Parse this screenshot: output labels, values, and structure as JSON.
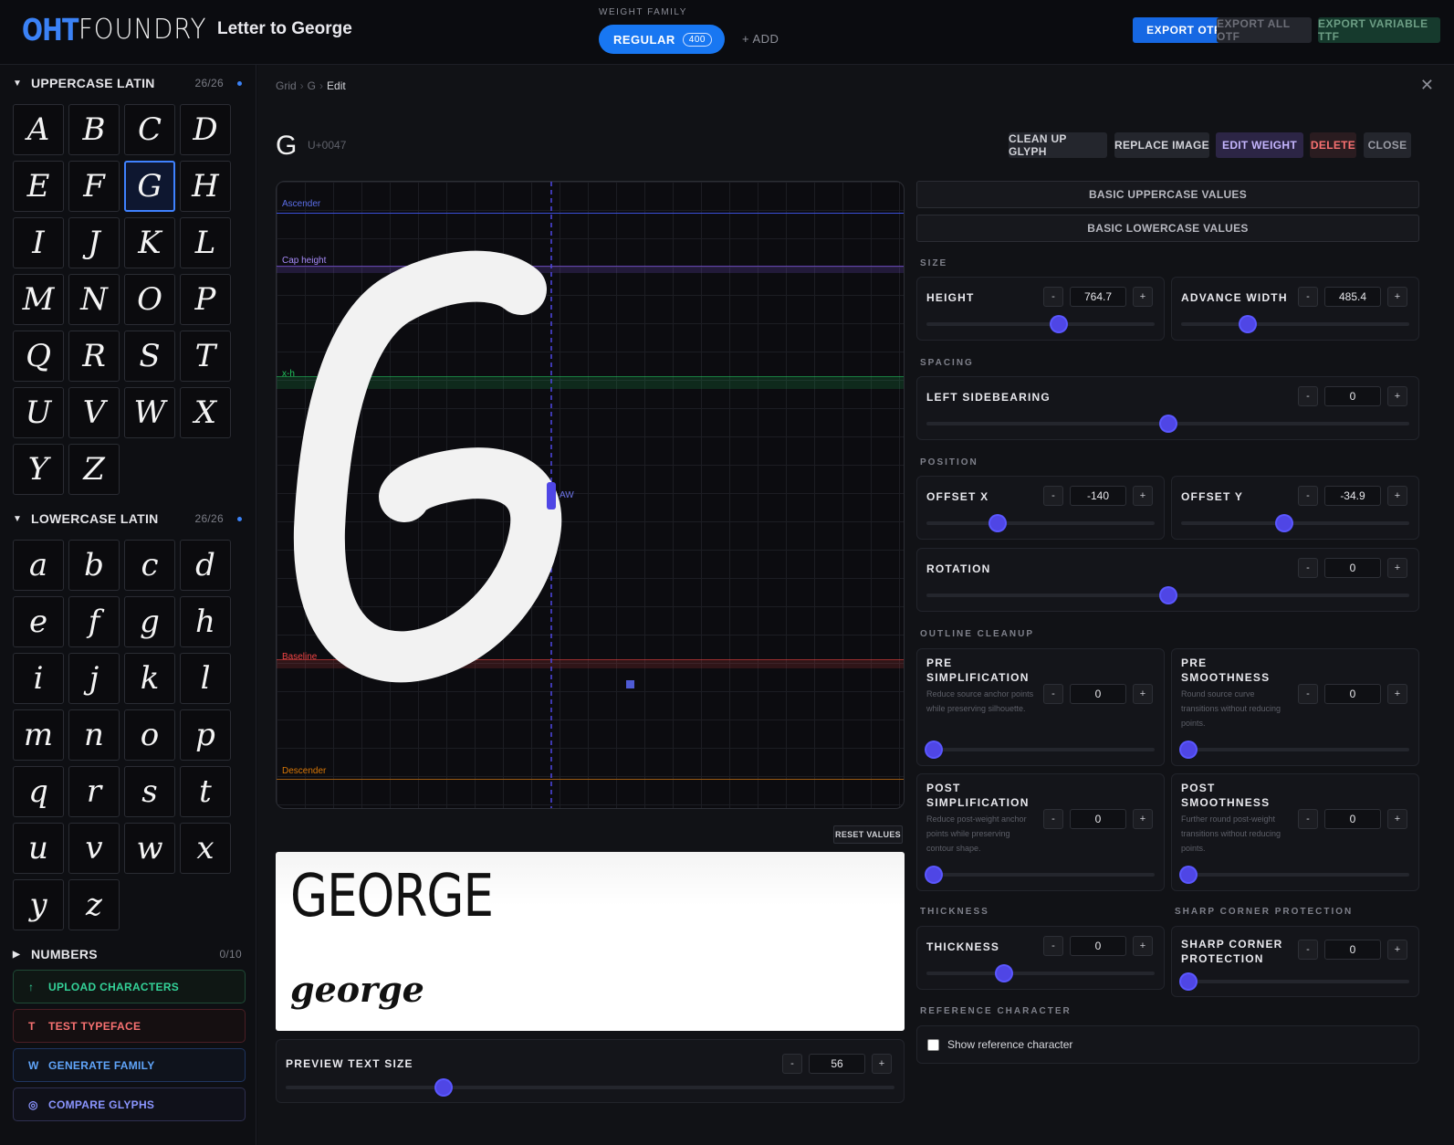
{
  "app": {
    "logo_left": "OHT",
    "logo_right": "FOUNDRY",
    "project_title": "Letter to George"
  },
  "weight_family": {
    "label": "WEIGHT FAMILY",
    "active_name": "REGULAR",
    "active_value": "400",
    "add_label": "+ ADD"
  },
  "export": {
    "otf": "EXPORT OTF",
    "all_otf": "EXPORT ALL OTF",
    "variable_ttf": "EXPORT VARIABLE TTF"
  },
  "sidebar": {
    "uppercase": {
      "title": "UPPERCASE LATIN",
      "count": "26/26",
      "glyphs": [
        "A",
        "B",
        "C",
        "D",
        "E",
        "F",
        "G",
        "H",
        "I",
        "J",
        "K",
        "L",
        "M",
        "N",
        "O",
        "P",
        "Q",
        "R",
        "S",
        "T",
        "U",
        "V",
        "W",
        "X",
        "Y",
        "Z"
      ]
    },
    "lowercase": {
      "title": "LOWERCASE LATIN",
      "count": "26/26",
      "glyphs": [
        "a",
        "b",
        "c",
        "d",
        "e",
        "f",
        "g",
        "h",
        "i",
        "j",
        "k",
        "l",
        "m",
        "n",
        "o",
        "p",
        "q",
        "r",
        "s",
        "t",
        "u",
        "v",
        "w",
        "x",
        "y",
        "z"
      ]
    },
    "numbers": {
      "title": "NUMBERS",
      "count": "0/10"
    },
    "actions": {
      "upload": "UPLOAD CHARACTERS",
      "test": "TEST TYPEFACE",
      "generate": "GENERATE FAMILY",
      "compare": "COMPARE GLYPHS",
      "upload_icon": "↑",
      "test_icon": "T",
      "generate_icon": "W",
      "compare_icon": "◎"
    }
  },
  "breadcrumb": {
    "grid": "Grid",
    "glyph": "G",
    "current": "Edit",
    "sep": "›"
  },
  "glyph": {
    "char": "G",
    "unicode": "U+0047",
    "buttons": {
      "cleanup": "CLEAN UP GLYPH",
      "replace": "REPLACE IMAGE",
      "edit_weight": "EDIT WEIGHT",
      "delete": "DELETE",
      "close": "CLOSE"
    }
  },
  "canvas": {
    "guides": {
      "ascender": "Ascender",
      "cap_height": "Cap height",
      "x_height": "x-h",
      "baseline": "Baseline",
      "descender": "Descender",
      "aw": "AW"
    },
    "colors": {
      "ascender": "#3b4fd8",
      "cap_height": "#8b5cf6",
      "x_height": "#22c55e",
      "baseline": "#ef4444",
      "descender": "#d97706",
      "advance": "#4f46e5"
    }
  },
  "preview": {
    "reset_label": "RESET VALUES",
    "upper_text": "GEORGE",
    "lower_text": "george",
    "size_label": "PREVIEW TEXT SIZE",
    "size_value": "56",
    "size_fraction": 0.26
  },
  "controls": {
    "basic_upper": "BASIC UPPERCASE VALUES",
    "basic_lower": "BASIC LOWERCASE VALUES",
    "minus": "-",
    "plus": "+",
    "size_group": "SIZE",
    "height": {
      "label": "HEIGHT",
      "value": "764.7",
      "fraction": 0.58
    },
    "advance_width": {
      "label": "ADVANCE WIDTH",
      "value": "485.4",
      "fraction": 0.29
    },
    "spacing_group": "SPACING",
    "left_sidebearing": {
      "label": "LEFT SIDEBEARING",
      "value": "0",
      "fraction": 0.5
    },
    "position_group": "POSITION",
    "offset_x": {
      "label": "OFFSET X",
      "value": "-140",
      "fraction": 0.31
    },
    "offset_y": {
      "label": "OFFSET Y",
      "value": "-34.9",
      "fraction": 0.45
    },
    "rotation": {
      "label": "ROTATION",
      "value": "0",
      "fraction": 0.5
    },
    "cleanup_group": "OUTLINE CLEANUP",
    "pre_simplification": {
      "label_1": "PRE",
      "label_2": "SIMPLIFICATION",
      "desc": "Reduce source anchor points while preserving silhouette.",
      "value": "0",
      "fraction": 0.03
    },
    "pre_smoothness": {
      "label_1": "PRE",
      "label_2": "SMOOTHNESS",
      "desc": "Round source curve transitions without reducing points.",
      "value": "0",
      "fraction": 0.03
    },
    "post_simplification": {
      "label_1": "POST",
      "label_2": "SIMPLIFICATION",
      "desc": "Reduce post-weight anchor points while preserving contour shape.",
      "value": "0",
      "fraction": 0.03
    },
    "post_smoothness": {
      "label_1": "POST",
      "label_2": "SMOOTHNESS",
      "desc": "Further round post-weight transitions without reducing points.",
      "value": "0",
      "fraction": 0.03
    },
    "thickness_group": "THICKNESS",
    "thickness": {
      "label": "THICKNESS",
      "value": "0",
      "fraction": 0.34
    },
    "sharp_group": "SHARP CORNER PROTECTION",
    "sharp": {
      "label_1": "SHARP CORNER",
      "label_2": "PROTECTION",
      "value": "0",
      "fraction": 0.03
    },
    "reference_group": "REFERENCE CHARACTER",
    "reference_label": "Show reference character"
  }
}
